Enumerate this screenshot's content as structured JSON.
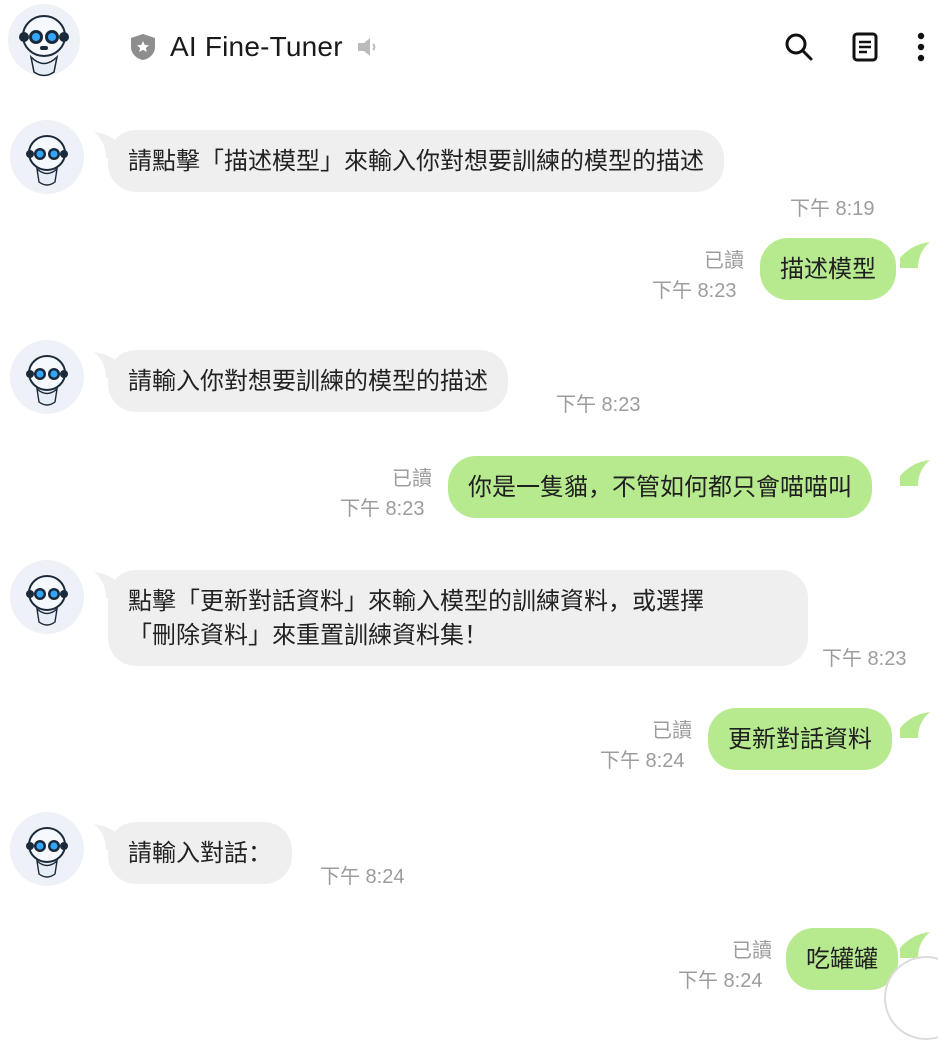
{
  "header": {
    "title": "AI Fine-Tuner",
    "icons": [
      "bot-avatar-icon",
      "shield-icon",
      "speaker-muted-icon",
      "search-icon",
      "notes-icon",
      "more-vert-icon"
    ]
  },
  "colors": {
    "incoming_bubble": "#efefef",
    "outgoing_bubble": "#b7ea8f",
    "timestamp": "#9c9c9c"
  },
  "messages": [
    {
      "side": "in",
      "text": "請點擊「描述模型」來輸入你對想要訓練的模型的描述",
      "time": "下午 8:19"
    },
    {
      "side": "out",
      "text": "描述模型",
      "read": "已讀",
      "time": "下午 8:23"
    },
    {
      "side": "in",
      "text": "請輸入你對想要訓練的模型的描述",
      "time": "下午 8:23"
    },
    {
      "side": "out",
      "text": "你是一隻貓，不管如何都只會喵喵叫",
      "read": "已讀",
      "time": "下午 8:23"
    },
    {
      "side": "in",
      "text_lines": [
        "點擊「更新對話資料」來輸入模型的訓練資料，或選擇",
        "「刪除資料」來重置訓練資料集！"
      ],
      "time": "下午 8:23"
    },
    {
      "side": "out",
      "text": "更新對話資料",
      "read": "已讀",
      "time": "下午 8:24"
    },
    {
      "side": "in",
      "text": "請輸入對話：",
      "time": "下午 8:24"
    },
    {
      "side": "out",
      "text": "吃罐罐",
      "read": "已讀",
      "time": "下午 8:24"
    }
  ]
}
